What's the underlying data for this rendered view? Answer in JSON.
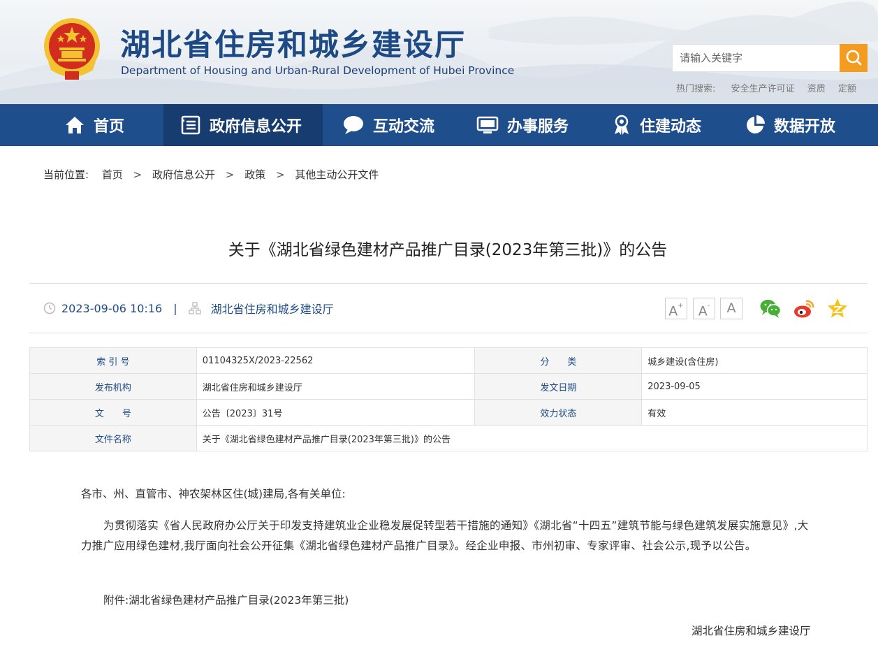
{
  "header": {
    "title": "湖北省住房和城乡建设厅",
    "subtitle": "Department of Housing and Urban-Rural Development of Hubei Province",
    "search_placeholder": "请输入关键字",
    "hot_label": "热门搜索:",
    "hot_items": [
      "安全生产许可证",
      "资质",
      "定额"
    ]
  },
  "nav": {
    "items": [
      {
        "label": "首页",
        "icon": "home-icon"
      },
      {
        "label": "政府信息公开",
        "icon": "document-list-icon"
      },
      {
        "label": "互动交流",
        "icon": "chat-bubble-icon"
      },
      {
        "label": "办事服务",
        "icon": "monitor-icon"
      },
      {
        "label": "住建动态",
        "icon": "ribbon-badge-icon"
      },
      {
        "label": "数据开放",
        "icon": "pie-chart-icon"
      }
    ],
    "active_index": 1
  },
  "breadcrumb": {
    "prefix": "当前位置:",
    "items": [
      "首页",
      "政府信息公开",
      "政策",
      "其他主动公开文件"
    ],
    "separator": ">"
  },
  "article": {
    "title": "关于《湖北省绿色建材产品推广目录(2023年第三批)》的公告",
    "datetime": "2023-09-06 10:16",
    "source": "湖北省住房和城乡建设厅",
    "font_buttons": [
      "A+",
      "A-",
      "A"
    ]
  },
  "info": {
    "index_label": "索 引 号",
    "index_value": "01104325X/2023-22562",
    "category_label": "分　　类",
    "category_value": "城乡建设(含住房)",
    "org_label": "发布机构",
    "org_value": "湖北省住房和城乡建设厅",
    "date_label": "发文日期",
    "date_value": "2023-09-05",
    "doc_label": "文　　号",
    "doc_value": "公告〔2023〕31号",
    "status_label": "效力状态",
    "status_value": "有效",
    "name_label": "文件名称",
    "name_value": "关于《湖北省绿色建材产品推广目录(2023年第三批)》的公告"
  },
  "body": {
    "greeting": "各市、州、直管市、神农架林区住(城)建局,各有关单位:",
    "paragraph": "为贯彻落实《省人民政府办公厅关于印发支持建筑业企业稳发展促转型若干措施的通知》《湖北省“十四五”建筑节能与绿色建筑发展实施意见》,大力推广应用绿色建材,我厅面向社会公开征集《湖北省绿色建材产品推广目录》。经企业申报、市州初审、专家评审、社会公示,现予以公告。",
    "attachment_prefix": "附件:",
    "attachment_link": "湖北省绿色建材产品推广目录(2023年第三批)",
    "signature": "湖北省住房和城乡建设厅"
  },
  "colors": {
    "nav_bg": "#1f4e8c",
    "nav_active": "#173d70",
    "title_blue": "#1d4a85",
    "search_orange": "#f49c20"
  }
}
